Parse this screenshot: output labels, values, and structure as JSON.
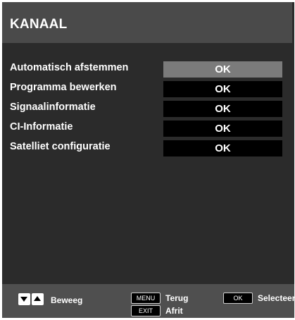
{
  "header": {
    "title": "KANAAL"
  },
  "menu": {
    "items": [
      {
        "label": "Automatisch afstemmen",
        "value": "OK"
      },
      {
        "label": "Programma bewerken",
        "value": "OK"
      },
      {
        "label": "Signaalinformatie",
        "value": "OK"
      },
      {
        "label": "CI-Informatie",
        "value": "OK"
      },
      {
        "label": "Satelliet configuratie",
        "value": "OK"
      }
    ]
  },
  "footer": {
    "move_label": "Beweeg",
    "menu_key": "MENU",
    "back_label": "Terug",
    "ok_key": "OK",
    "select_label": "Selecteer",
    "exit_key": "EXIT",
    "exit_label": "Afrit"
  },
  "colors": {
    "panel": "#2b2b2b",
    "title_bar": "#4a4a4a",
    "selected_value": "#7b7b7b",
    "value_bg": "#000000"
  }
}
